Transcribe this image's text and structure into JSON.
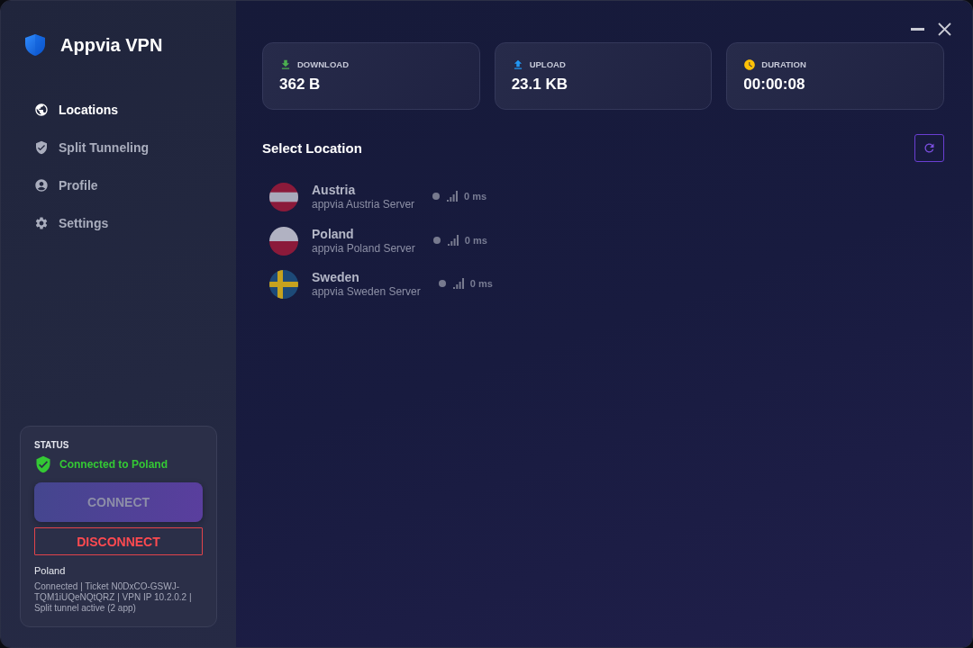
{
  "app": {
    "title": "Appvia VPN"
  },
  "sidebar": {
    "items": [
      {
        "label": "Locations",
        "selected": true
      },
      {
        "label": "Split Tunneling",
        "selected": false
      },
      {
        "label": "Profile",
        "selected": false
      },
      {
        "label": "Settings",
        "selected": false
      }
    ]
  },
  "status_panel": {
    "heading": "STATUS",
    "message": "Connected to Poland",
    "connected": true,
    "buttons": [
      {
        "kind": "connect",
        "label": "CONNECT",
        "disabled": true
      },
      {
        "kind": "disconnect",
        "label": "DISCONNECT",
        "disabled": false
      }
    ],
    "location": "Poland",
    "details": "Connected | Ticket N0DxCO-GSWJ-TQM1iUQeNQtQRZ | VPN IP 10.2.0.2 | Split tunnel active (2 app)"
  },
  "stats": [
    {
      "kind": "download",
      "label": "DOWNLOAD",
      "value": "362 B"
    },
    {
      "kind": "upload",
      "label": "UPLOAD",
      "value": "23.1 KB"
    },
    {
      "kind": "duration",
      "label": "DURATION",
      "value": "00:00:08"
    }
  ],
  "locations": {
    "title": "Select Location",
    "servers": [
      {
        "kind": "austria",
        "name": "Austria",
        "server": "appvia Austria Server",
        "latency": "0 ms"
      },
      {
        "kind": "poland",
        "name": "Poland",
        "server": "appvia Poland Server",
        "latency": "0 ms"
      },
      {
        "kind": "sweden",
        "name": "Sweden",
        "server": "appvia Sweden Server",
        "latency": "0 ms"
      }
    ]
  }
}
